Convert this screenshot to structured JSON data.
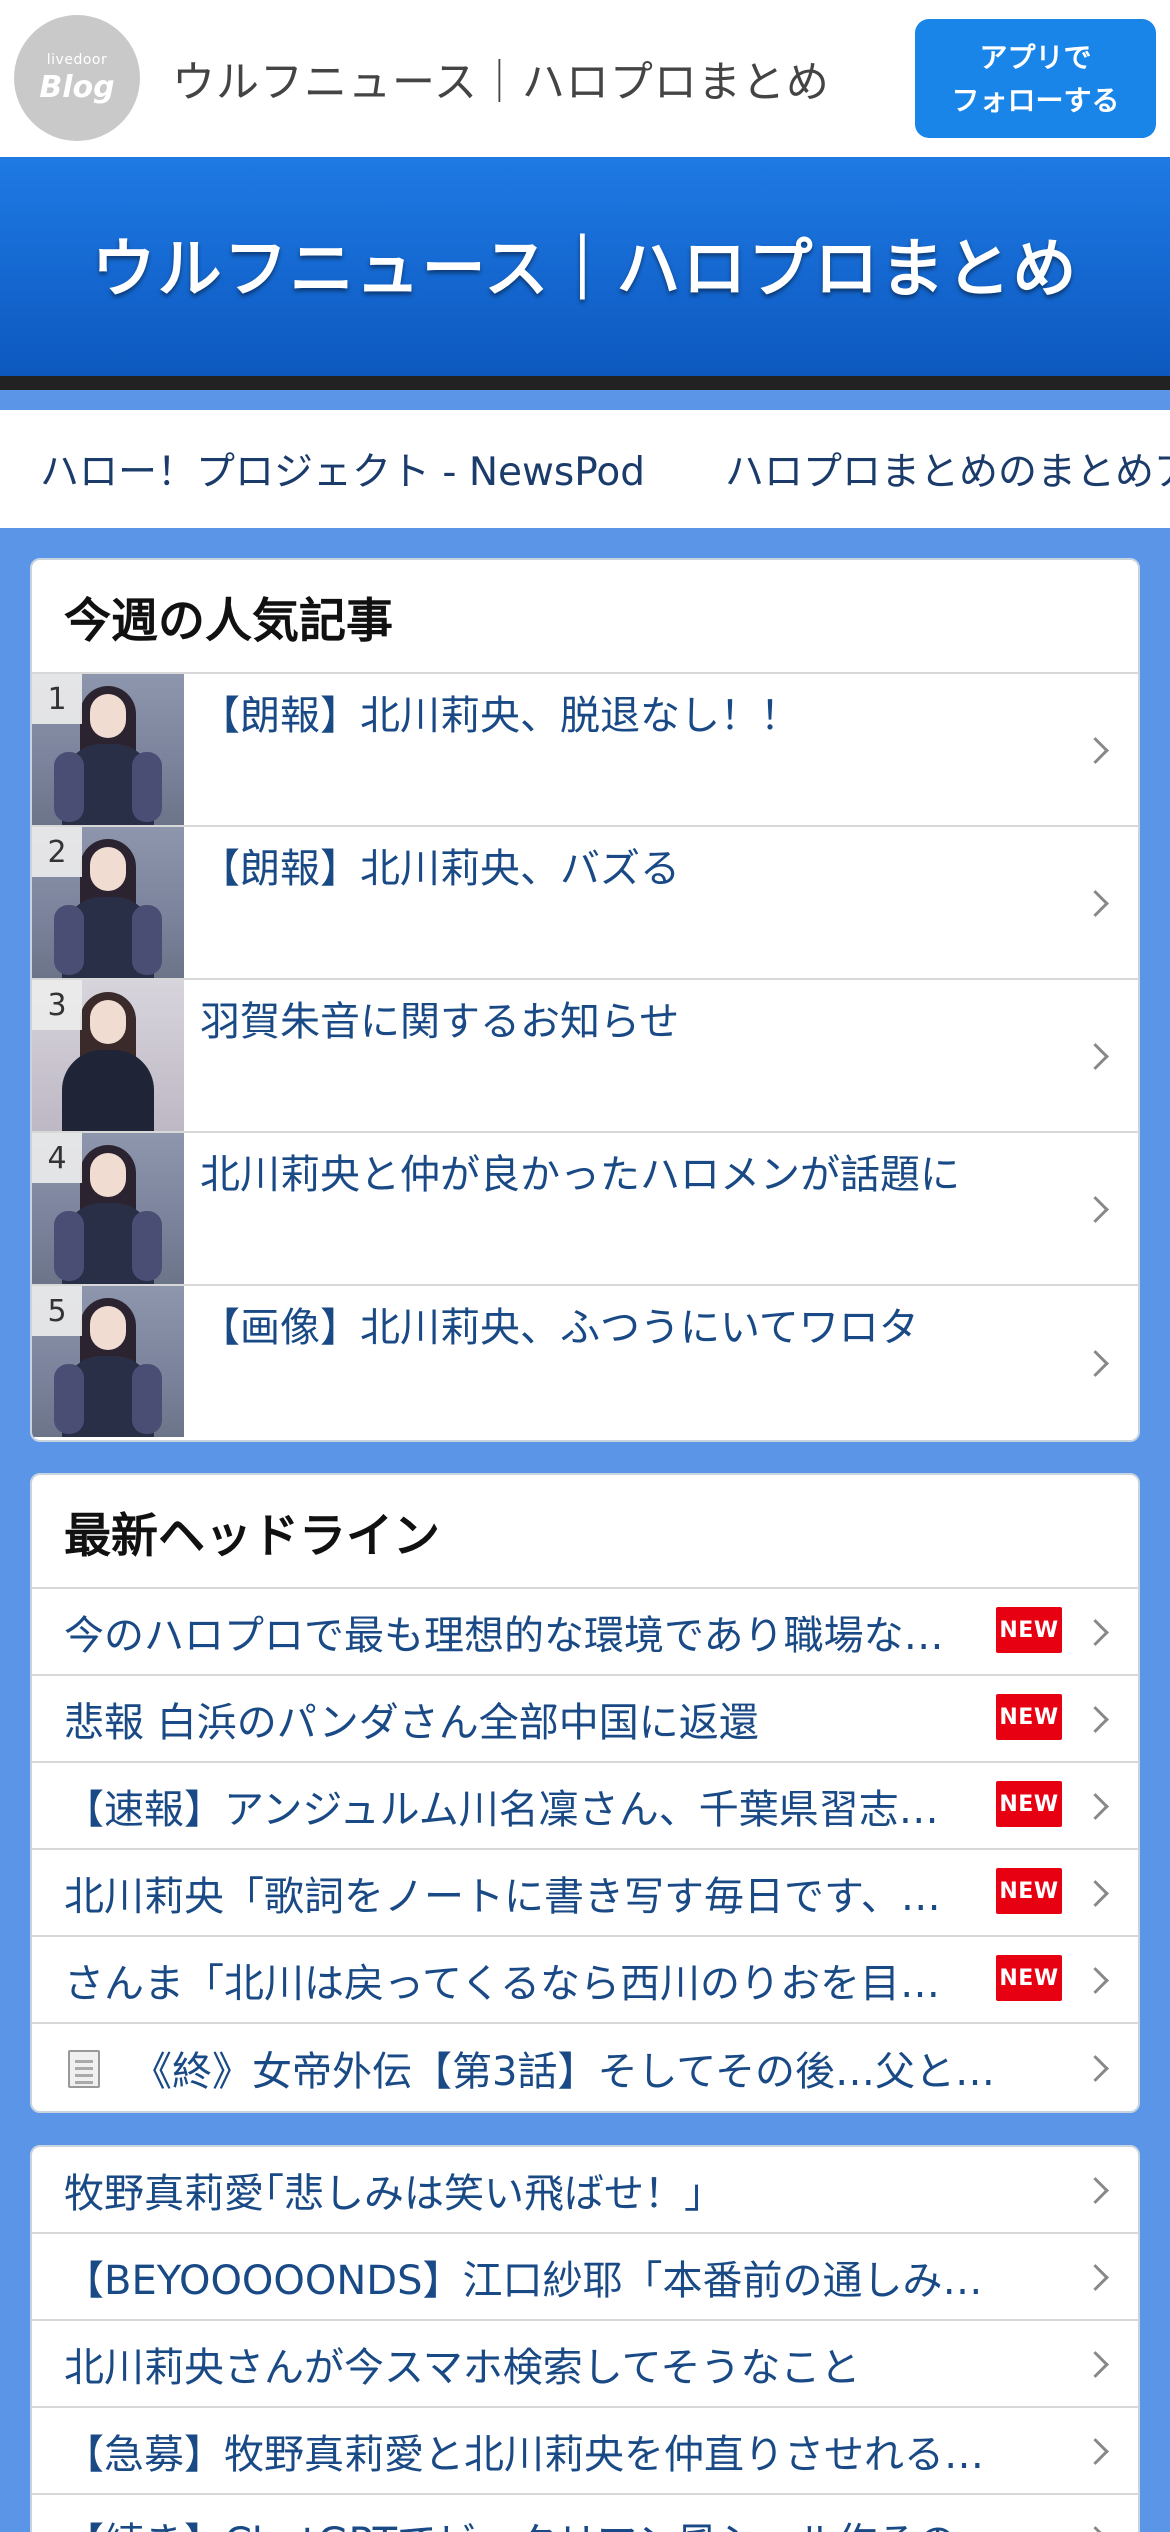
{
  "header": {
    "logo_small": "livedoor",
    "logo_big": "Blog",
    "site_name": "ウルフニュース｜ハロプロまとめ",
    "follow_button": "アプリで\nフォローする"
  },
  "banner": {
    "title": "ウルフニュース｜ハロプロまとめ"
  },
  "link_strip": [
    "ハロー！プロジェクト - NewsPod",
    "ハロプロまとめのまとめア"
  ],
  "popular": {
    "heading": "今週の人気記事",
    "items": [
      {
        "rank": "1",
        "title": "【朗報】北川莉央、脱退なし！！"
      },
      {
        "rank": "2",
        "title": "【朗報】北川莉央、バズる"
      },
      {
        "rank": "3",
        "title": "羽賀朱音に関するお知らせ"
      },
      {
        "rank": "4",
        "title": "北川莉央と仲が良かったハロメンが話題に"
      },
      {
        "rank": "5",
        "title": "【画像】北川莉央、ふつうにいてワロタ"
      }
    ]
  },
  "headlines": {
    "heading": "最新ヘッドライン",
    "new_label": "NEW",
    "items": [
      {
        "title": "今のハロプロで最も理想的な環境であり職場な…",
        "new": true
      },
      {
        "title": "悲報 白浜のパンダさん全部中国に返還",
        "new": true
      },
      {
        "title": "【速報】アンジュルム川名凜さん、千葉県習志…",
        "new": true
      },
      {
        "title": "北川莉央「歌詞をノートに書き写す毎日です、…",
        "new": true
      },
      {
        "title": "さんま「北川は戻ってくるなら西川のりおを目…",
        "new": true
      },
      {
        "title": "《終》女帝外伝【第3話】そしてその後…父と…",
        "new": false
      }
    ]
  },
  "more_links": {
    "items": [
      "牧野真莉愛｢悲しみは笑い飛ばせ！｣",
      "【BEYOOOOONDS】江口紗耶「本番前の通しみ…",
      "北川莉央さんが今スマホ検索してそうなこと",
      "【急募】牧野真莉愛と北川莉央を仲直りさせれる…",
      "【続き】ChatGPTでビックリマン風シール作るの…"
    ]
  },
  "colors": {
    "page_background": "#5b95e8",
    "banner": "#1672df",
    "follow_button": "#1a85e8",
    "link_text": "#1a4a86",
    "new_badge": "#e60012"
  }
}
